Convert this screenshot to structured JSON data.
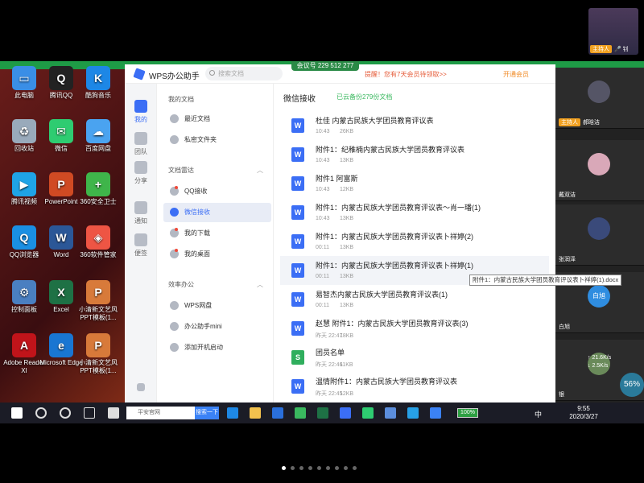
{
  "meeting": {
    "id_label": "会议号 229 512 277"
  },
  "top_thumb": {
    "label": "主持人",
    "name": "钊"
  },
  "desktop": {
    "icons": [
      {
        "label": "此电脑"
      },
      {
        "label": "腾讯QQ"
      },
      {
        "label": "酷狗音乐"
      },
      {
        "label": "回收站"
      },
      {
        "label": "微信"
      },
      {
        "label": "百度网盘"
      },
      {
        "label": "腾讯视频"
      },
      {
        "label": "PowerPoint"
      },
      {
        "label": "360安全卫士"
      },
      {
        "label": "QQ浏览器"
      },
      {
        "label": "Word"
      },
      {
        "label": "360软件管家"
      },
      {
        "label": "控制面板"
      },
      {
        "label": "Excel"
      },
      {
        "label": "小清新文艺风PPT模板(1..."
      },
      {
        "label": "Adobe Reader XI"
      },
      {
        "label": "Microsoft Edge"
      },
      {
        "label": "小清新文艺风PPT模板(1..."
      }
    ]
  },
  "wps": {
    "title": "WPS办公助手",
    "search_placeholder": "搜索文档",
    "notice": "提醒！您有7天会员待领取>>",
    "member": "开通会员",
    "nav": [
      {
        "label": "我的"
      },
      {
        "label": "团队"
      },
      {
        "label": "分享"
      },
      {
        "label": "通知"
      },
      {
        "label": "便签"
      }
    ],
    "side": {
      "my_docs": "我的文档",
      "recent": "最近文档",
      "private": "私密文件夹",
      "doc_section": "文档雷达",
      "qq": "QQ接收",
      "wechat": "微信接收",
      "downloads": "我的下载",
      "desktop": "我的桌面",
      "efficiency": "效率办公",
      "wps_disk": "WPS网盘",
      "mini": "办公助手mini",
      "autostart": "添加开机启动"
    },
    "main": {
      "title": "微信接收",
      "backup": "已云备份279份文档",
      "files": [
        {
          "name": "杜佳 内蒙古民族大学团员教育评议表",
          "time": "10:43",
          "size": "26KB",
          "icon": "W"
        },
        {
          "name": "附件1：纪稚楠内蒙古民族大学团员教育评议表",
          "time": "10:43",
          "size": "13KB",
          "icon": "W"
        },
        {
          "name": "附件1  阿富斯",
          "time": "10:43",
          "size": "12KB",
          "icon": "W"
        },
        {
          "name": "附件1：内蒙古民族大学团员教育评议表～肖一璠(1)",
          "time": "10:43",
          "size": "13KB",
          "icon": "W"
        },
        {
          "name": "附件1：内蒙古民族大学团员教育评议表卜祥婷(2)",
          "time": "00:11",
          "size": "13KB",
          "icon": "W"
        },
        {
          "name": "附件1：内蒙古民族大学团员教育评议表卜祥婷(1)",
          "time": "00:11",
          "size": "13KB",
          "icon": "W"
        },
        {
          "name": "易智杰内蒙古民族大学团员教育评议表(1)",
          "time": "00:11",
          "size": "13KB",
          "icon": "W"
        },
        {
          "name": "赵慧 附件1：内蒙古民族大学团员教育评议表(3)",
          "time": "昨天 22:47",
          "size": "18KB",
          "icon": "W"
        },
        {
          "name": "团员名单",
          "time": "昨天 22:46",
          "size": "11KB",
          "icon": "S"
        },
        {
          "name": "温情附件1：内蒙古民族大学团员教育评议表",
          "time": "昨天 22:45",
          "size": "12KB",
          "icon": "W"
        }
      ],
      "tooltip": "附件1：内蒙古民族大学团员教育评议表卜祥婷(1).docx"
    }
  },
  "video": {
    "participants": [
      {
        "name": "郝晗洁",
        "host": "主持人"
      },
      {
        "name": "戴双洁",
        "host": ""
      },
      {
        "name": "张润泽",
        "host": ""
      },
      {
        "name": "白旭",
        "host": "",
        "avatar_text": "白旭"
      },
      {
        "name": "银",
        "host": ""
      }
    ]
  },
  "taskbar": {
    "search_text": "平安官网",
    "search_btn": "搜索一下",
    "battery": "100%",
    "ime": "中",
    "time": "9:55",
    "date": "2020/3/27"
  },
  "net": {
    "up": "21.6K/s",
    "down": "2.5K/s",
    "pct": "56%"
  }
}
